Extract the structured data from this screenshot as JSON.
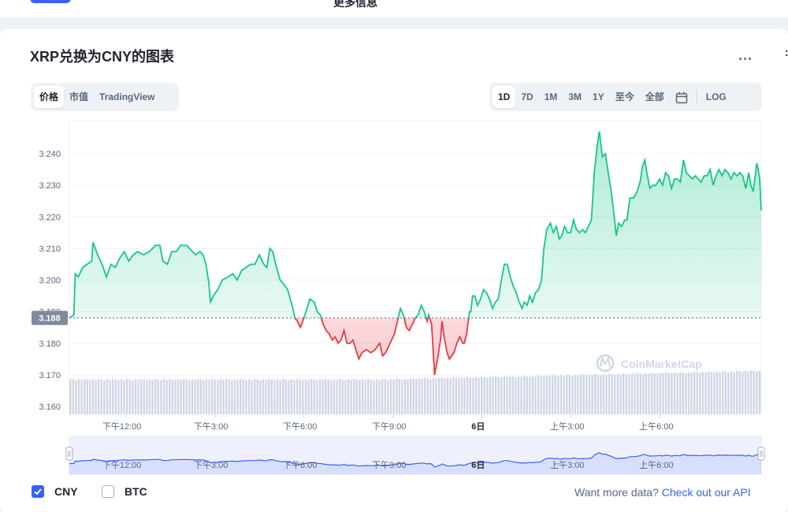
{
  "topbar": {
    "more_label": "更多信息"
  },
  "title": "XRP兑换为CNY的图表",
  "menu_dots": "...",
  "edge_char": ":",
  "type_tabs": [
    "价格",
    "市值",
    "TradingView"
  ],
  "range_tabs": [
    "1D",
    "7D",
    "1M",
    "3M",
    "1Y",
    "至今",
    "全部"
  ],
  "log_label": "LOG",
  "watermark": "CoinMarketCap",
  "legend": {
    "cny": "CNY",
    "btc": "BTC"
  },
  "api": {
    "text": "Want more data?",
    "link": "Check out our API"
  },
  "colors": {
    "up": "#16c784",
    "down": "#ea3943",
    "accent": "#3861fb",
    "volume": "#cfd6e4"
  },
  "chart_data": {
    "type": "line",
    "y_ticks": [
      "3.240",
      "3.230",
      "3.220",
      "3.210",
      "3.200",
      "3.190",
      "3.180",
      "3.170",
      "3.160"
    ],
    "ylim": [
      3.1575,
      3.2505
    ],
    "baseline": 3.188,
    "baseline_label": "3.188",
    "x_ticks": [
      {
        "label": "下午12:00",
        "t": 1.9,
        "bold": false
      },
      {
        "label": "下午3:00",
        "t": 4.9,
        "bold": false
      },
      {
        "label": "下午6:00",
        "t": 7.9,
        "bold": false
      },
      {
        "label": "下午9:00",
        "t": 10.9,
        "bold": false
      },
      {
        "label": "6日",
        "t": 13.9,
        "bold": true
      },
      {
        "label": "上午3:00",
        "t": 16.9,
        "bold": false
      },
      {
        "label": "上午6:00",
        "t": 19.9,
        "bold": false
      }
    ],
    "xlim": [
      0,
      23.3
    ],
    "price": [
      [
        0.0,
        3.188
      ],
      [
        0.15,
        3.189
      ],
      [
        0.2,
        3.202
      ],
      [
        0.3,
        3.201
      ],
      [
        0.45,
        3.204
      ],
      [
        0.6,
        3.205
      ],
      [
        0.75,
        3.206
      ],
      [
        0.8,
        3.212
      ],
      [
        0.95,
        3.208
      ],
      [
        1.1,
        3.205
      ],
      [
        1.25,
        3.201
      ],
      [
        1.4,
        3.205
      ],
      [
        1.55,
        3.204
      ],
      [
        1.7,
        3.207
      ],
      [
        1.85,
        3.209
      ],
      [
        2.0,
        3.206
      ],
      [
        2.15,
        3.208
      ],
      [
        2.3,
        3.209
      ],
      [
        2.5,
        3.208
      ],
      [
        2.7,
        3.209
      ],
      [
        2.9,
        3.211
      ],
      [
        3.05,
        3.211
      ],
      [
        3.15,
        3.206
      ],
      [
        3.3,
        3.205
      ],
      [
        3.45,
        3.209
      ],
      [
        3.6,
        3.209
      ],
      [
        3.75,
        3.211
      ],
      [
        3.95,
        3.211
      ],
      [
        4.15,
        3.209
      ],
      [
        4.25,
        3.208
      ],
      [
        4.4,
        3.209
      ],
      [
        4.5,
        3.208
      ],
      [
        4.6,
        3.205
      ],
      [
        4.7,
        3.199
      ],
      [
        4.75,
        3.193
      ],
      [
        4.85,
        3.195
      ],
      [
        5.0,
        3.197
      ],
      [
        5.15,
        3.2
      ],
      [
        5.35,
        3.201
      ],
      [
        5.5,
        3.202
      ],
      [
        5.65,
        3.2
      ],
      [
        5.8,
        3.203
      ],
      [
        5.95,
        3.204
      ],
      [
        6.1,
        3.205
      ],
      [
        6.25,
        3.205
      ],
      [
        6.4,
        3.208
      ],
      [
        6.55,
        3.205
      ],
      [
        6.65,
        3.204
      ],
      [
        6.75,
        3.21
      ],
      [
        6.85,
        3.209
      ],
      [
        6.95,
        3.205
      ],
      [
        7.1,
        3.2
      ],
      [
        7.2,
        3.199
      ],
      [
        7.35,
        3.197
      ],
      [
        7.5,
        3.192
      ],
      [
        7.6,
        3.188
      ],
      [
        7.68,
        3.187
      ],
      [
        7.78,
        3.185
      ],
      [
        7.9,
        3.188
      ],
      [
        8.0,
        3.191
      ],
      [
        8.1,
        3.194
      ],
      [
        8.25,
        3.193
      ],
      [
        8.35,
        3.19
      ],
      [
        8.45,
        3.189
      ],
      [
        8.55,
        3.186
      ],
      [
        8.65,
        3.184
      ],
      [
        8.75,
        3.183
      ],
      [
        8.85,
        3.181
      ],
      [
        8.95,
        3.182
      ],
      [
        9.05,
        3.18
      ],
      [
        9.15,
        3.181
      ],
      [
        9.25,
        3.184
      ],
      [
        9.35,
        3.18
      ],
      [
        9.45,
        3.18
      ],
      [
        9.55,
        3.181
      ],
      [
        9.65,
        3.178
      ],
      [
        9.75,
        3.175
      ],
      [
        9.85,
        3.177
      ],
      [
        10.0,
        3.178
      ],
      [
        10.15,
        3.177
      ],
      [
        10.3,
        3.178
      ],
      [
        10.45,
        3.18
      ],
      [
        10.55,
        3.176
      ],
      [
        10.65,
        3.177
      ],
      [
        10.75,
        3.179
      ],
      [
        10.85,
        3.181
      ],
      [
        10.95,
        3.183
      ],
      [
        11.05,
        3.187
      ],
      [
        11.15,
        3.191
      ],
      [
        11.25,
        3.189
      ],
      [
        11.35,
        3.185
      ],
      [
        11.45,
        3.184
      ],
      [
        11.55,
        3.186
      ],
      [
        11.65,
        3.188
      ],
      [
        11.75,
        3.189
      ],
      [
        11.85,
        3.192
      ],
      [
        11.95,
        3.19
      ],
      [
        12.05,
        3.187
      ],
      [
        12.1,
        3.189
      ],
      [
        12.2,
        3.186
      ],
      [
        12.3,
        3.17
      ],
      [
        12.4,
        3.175
      ],
      [
        12.5,
        3.181
      ],
      [
        12.55,
        3.187
      ],
      [
        12.62,
        3.182
      ],
      [
        12.72,
        3.177
      ],
      [
        12.8,
        3.175
      ],
      [
        12.95,
        3.177
      ],
      [
        13.05,
        3.18
      ],
      [
        13.15,
        3.182
      ],
      [
        13.25,
        3.18
      ],
      [
        13.3,
        3.18
      ],
      [
        13.38,
        3.183
      ],
      [
        13.42,
        3.186
      ],
      [
        13.48,
        3.19
      ],
      [
        13.52,
        3.19
      ],
      [
        13.58,
        3.195
      ],
      [
        13.65,
        3.195
      ],
      [
        13.75,
        3.192
      ],
      [
        13.85,
        3.194
      ],
      [
        13.95,
        3.197
      ],
      [
        14.05,
        3.196
      ],
      [
        14.15,
        3.194
      ],
      [
        14.25,
        3.191
      ],
      [
        14.35,
        3.193
      ],
      [
        14.45,
        3.194
      ],
      [
        14.55,
        3.2
      ],
      [
        14.65,
        3.205
      ],
      [
        14.75,
        3.205
      ],
      [
        14.85,
        3.201
      ],
      [
        14.95,
        3.198
      ],
      [
        15.05,
        3.196
      ],
      [
        15.15,
        3.193
      ],
      [
        15.25,
        3.191
      ],
      [
        15.32,
        3.193
      ],
      [
        15.42,
        3.192
      ],
      [
        15.5,
        3.195
      ],
      [
        15.6,
        3.193
      ],
      [
        15.7,
        3.196
      ],
      [
        15.8,
        3.197
      ],
      [
        15.9,
        3.2
      ],
      [
        15.98,
        3.21
      ],
      [
        16.08,
        3.216
      ],
      [
        16.2,
        3.218
      ],
      [
        16.3,
        3.215
      ],
      [
        16.4,
        3.217
      ],
      [
        16.5,
        3.213
      ],
      [
        16.58,
        3.214
      ],
      [
        16.68,
        3.217
      ],
      [
        16.78,
        3.215
      ],
      [
        16.88,
        3.215
      ],
      [
        16.98,
        3.219
      ],
      [
        17.08,
        3.216
      ],
      [
        17.18,
        3.215
      ],
      [
        17.28,
        3.216
      ],
      [
        17.38,
        3.215
      ],
      [
        17.48,
        3.217
      ],
      [
        17.58,
        3.219
      ],
      [
        17.68,
        3.234
      ],
      [
        17.78,
        3.243
      ],
      [
        17.85,
        3.247
      ],
      [
        17.95,
        3.239
      ],
      [
        18.05,
        3.24
      ],
      [
        18.15,
        3.234
      ],
      [
        18.25,
        3.228
      ],
      [
        18.35,
        3.22
      ],
      [
        18.42,
        3.214
      ],
      [
        18.5,
        3.218
      ],
      [
        18.6,
        3.217
      ],
      [
        18.7,
        3.219
      ],
      [
        18.78,
        3.219
      ],
      [
        18.88,
        3.226
      ],
      [
        19.0,
        3.226
      ],
      [
        19.12,
        3.228
      ],
      [
        19.22,
        3.231
      ],
      [
        19.3,
        3.236
      ],
      [
        19.38,
        3.238
      ],
      [
        19.45,
        3.234
      ],
      [
        19.55,
        3.229
      ],
      [
        19.65,
        3.23
      ],
      [
        19.75,
        3.23
      ],
      [
        19.88,
        3.232
      ],
      [
        19.98,
        3.23
      ],
      [
        20.08,
        3.234
      ],
      [
        20.18,
        3.233
      ],
      [
        20.28,
        3.229
      ],
      [
        20.38,
        3.232
      ],
      [
        20.48,
        3.232
      ],
      [
        20.58,
        3.231
      ],
      [
        20.68,
        3.238
      ],
      [
        20.78,
        3.234
      ],
      [
        20.88,
        3.233
      ],
      [
        20.98,
        3.232
      ],
      [
        21.08,
        3.233
      ],
      [
        21.18,
        3.232
      ],
      [
        21.28,
        3.231
      ],
      [
        21.38,
        3.233
      ],
      [
        21.48,
        3.233
      ],
      [
        21.58,
        3.235
      ],
      [
        21.68,
        3.23
      ],
      [
        21.78,
        3.233
      ],
      [
        21.88,
        3.235
      ],
      [
        21.98,
        3.233
      ],
      [
        22.08,
        3.235
      ],
      [
        22.18,
        3.234
      ],
      [
        22.28,
        3.232
      ],
      [
        22.38,
        3.234
      ],
      [
        22.48,
        3.233
      ],
      [
        22.58,
        3.234
      ],
      [
        22.68,
        3.233
      ],
      [
        22.78,
        3.229
      ],
      [
        22.88,
        3.234
      ],
      [
        22.95,
        3.23
      ],
      [
        23.03,
        3.228
      ],
      [
        23.1,
        3.233
      ],
      [
        23.15,
        3.237
      ],
      [
        23.2,
        3.235
      ],
      [
        23.25,
        3.232
      ],
      [
        23.3,
        3.222
      ]
    ]
  }
}
